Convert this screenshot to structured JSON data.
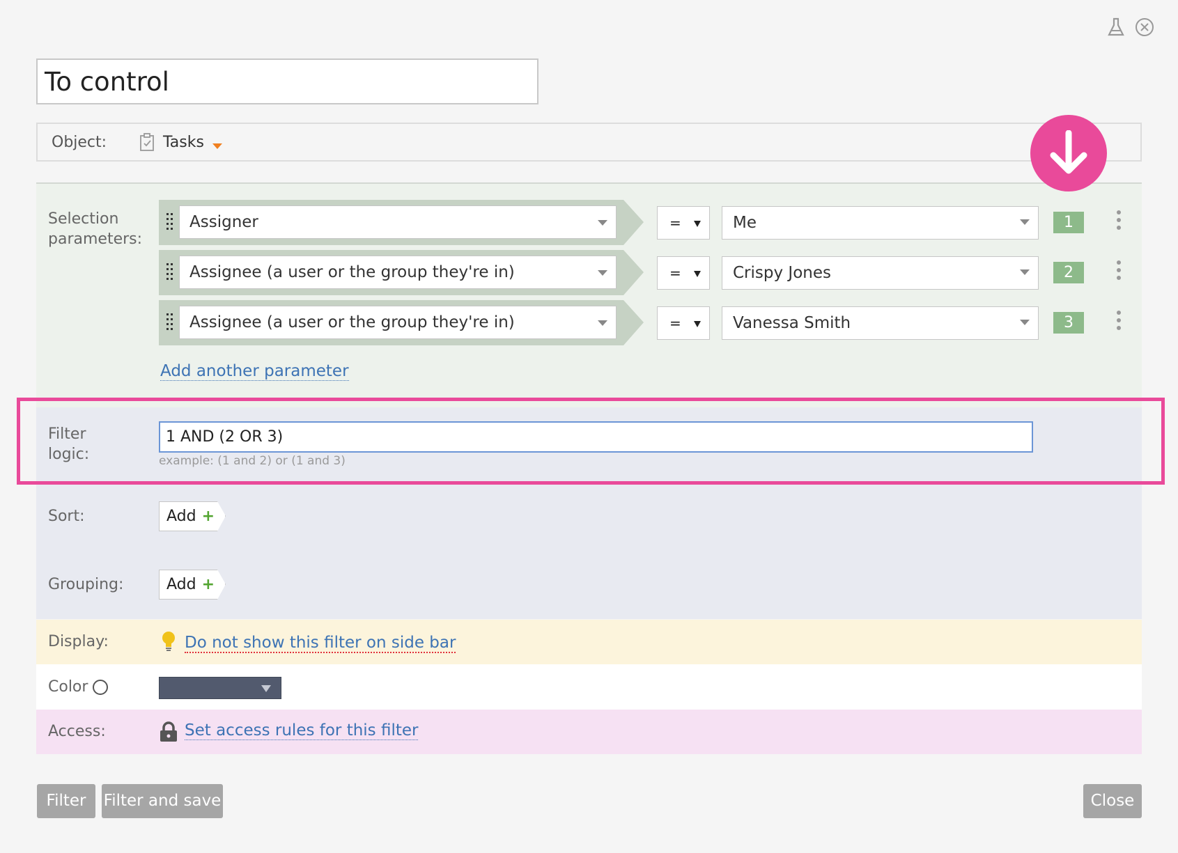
{
  "filter_title": "To control",
  "object": {
    "label": "Object:",
    "value": "Tasks"
  },
  "selection": {
    "label": "Selection parameters:",
    "parameters": [
      {
        "field": "Assigner",
        "operator": "=",
        "value": "Me",
        "number": "1"
      },
      {
        "field": "Assignee (a user or the group they're in)",
        "operator": "=",
        "value": "Crispy Jones",
        "number": "2"
      },
      {
        "field": "Assignee (a user or the group they're in)",
        "operator": "=",
        "value": "Vanessa Smith",
        "number": "3"
      }
    ],
    "add_parameter": "Add another parameter"
  },
  "filter_logic": {
    "label": "Filter logic:",
    "value": "1 AND (2 OR 3)",
    "hint": "example: (1 and 2) or (1 and 3)"
  },
  "sort": {
    "label": "Sort:",
    "add": "Add"
  },
  "grouping": {
    "label": "Grouping:",
    "add": "Add"
  },
  "display": {
    "label": "Display:",
    "link": "Do not show this filter on side bar"
  },
  "color": {
    "label": "Color",
    "selected_color": "#525a6e"
  },
  "access": {
    "label": "Access:",
    "link": "Set access rules for this filter"
  },
  "buttons": {
    "filter": "Filter",
    "filter_save": "Filter and save",
    "close": "Close"
  },
  "colors": {
    "accent": "#e94a9a",
    "badge": "#8dba8a",
    "link": "#3d73b4"
  }
}
